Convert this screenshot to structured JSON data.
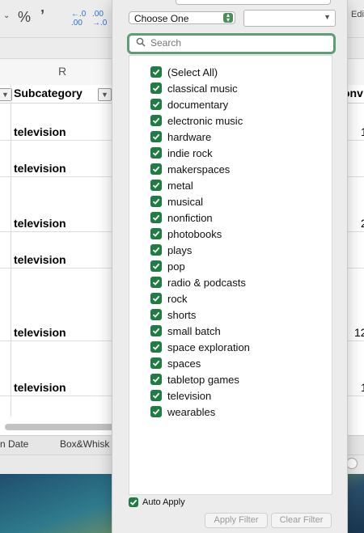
{
  "ribbon": {
    "percent_symbol": "%",
    "comma_symbol": "\"",
    "dec_decrease": "←.0 .00",
    "dec_increase": ".00 →.0",
    "edit_label": "Edi"
  },
  "sheet": {
    "column_letter": "R",
    "header_subcategory": "Subcategory",
    "header_partial_right": "onv",
    "rows": [
      {
        "subcategory": "television",
        "right_val": "1"
      },
      {
        "subcategory": "television",
        "right_val": ""
      },
      {
        "subcategory": "television",
        "right_val": "2"
      },
      {
        "subcategory": "television",
        "right_val": ""
      },
      {
        "subcategory": "television",
        "right_val": "12"
      },
      {
        "subcategory": "television",
        "right_val": "1"
      }
    ],
    "tabs": [
      "n Date",
      "Box&Whisk"
    ]
  },
  "filter_popup": {
    "condition_select": "Choose One",
    "search_placeholder": "Search",
    "items": [
      {
        "label": "(Select All)",
        "checked": true
      },
      {
        "label": "classical music",
        "checked": true
      },
      {
        "label": "documentary",
        "checked": true
      },
      {
        "label": "electronic music",
        "checked": true
      },
      {
        "label": "hardware",
        "checked": true
      },
      {
        "label": "indie rock",
        "checked": true
      },
      {
        "label": "makerspaces",
        "checked": true
      },
      {
        "label": "metal",
        "checked": true
      },
      {
        "label": "musical",
        "checked": true
      },
      {
        "label": "nonfiction",
        "checked": true
      },
      {
        "label": "photobooks",
        "checked": true
      },
      {
        "label": "plays",
        "checked": true
      },
      {
        "label": "pop",
        "checked": true
      },
      {
        "label": "radio & podcasts",
        "checked": true
      },
      {
        "label": "rock",
        "checked": true
      },
      {
        "label": "shorts",
        "checked": true
      },
      {
        "label": "small batch",
        "checked": true
      },
      {
        "label": "space exploration",
        "checked": true
      },
      {
        "label": "spaces",
        "checked": true
      },
      {
        "label": "tabletop games",
        "checked": true
      },
      {
        "label": "television",
        "checked": true
      },
      {
        "label": "wearables",
        "checked": true
      }
    ],
    "auto_apply_label": "Auto Apply",
    "apply_button": "Apply Filter",
    "clear_button": "Clear Filter",
    "accent_color": "#1f7d44",
    "search_focus_color": "#5b9e77"
  }
}
